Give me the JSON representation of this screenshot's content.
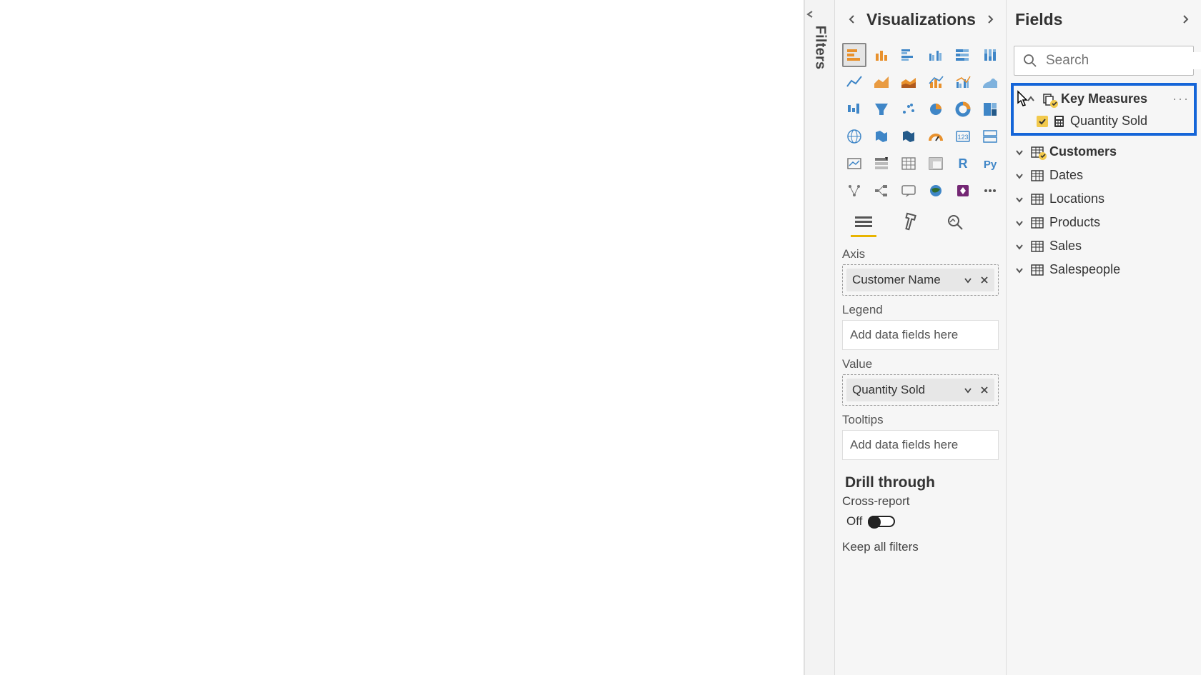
{
  "filters": {
    "label": "Filters"
  },
  "visualizations": {
    "title": "Visualizations",
    "wells": {
      "axis_label": "Axis",
      "axis_field": "Customer Name",
      "legend_label": "Legend",
      "legend_placeholder": "Add data fields here",
      "value_label": "Value",
      "value_field": "Quantity Sold",
      "tooltips_label": "Tooltips",
      "tooltips_placeholder": "Add data fields here"
    },
    "drill": {
      "title": "Drill through",
      "cross_report_label": "Cross-report",
      "cross_report_state": "Off",
      "keep_all_label": "Keep all filters"
    }
  },
  "fields": {
    "title": "Fields",
    "search_placeholder": "Search",
    "tables": {
      "key_measures": "Key Measures",
      "key_measures_child": "Quantity Sold",
      "customers": "Customers",
      "dates": "Dates",
      "locations": "Locations",
      "products": "Products",
      "sales": "Sales",
      "salespeople": "Salespeople"
    }
  }
}
